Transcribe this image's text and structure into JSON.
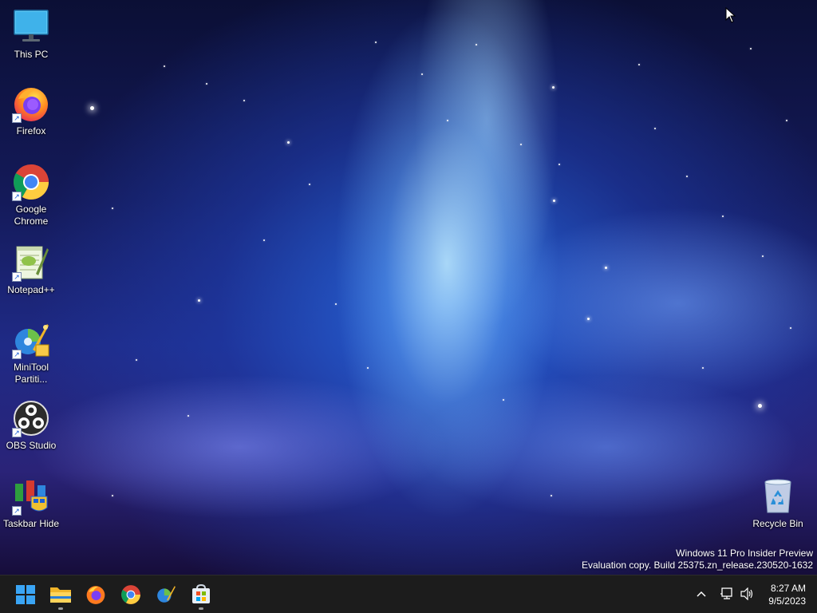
{
  "desktop": {
    "icons": [
      {
        "label": "This PC",
        "icon": "monitor-icon"
      },
      {
        "label": "Firefox",
        "icon": "firefox-icon"
      },
      {
        "label": "Google\nChrome",
        "icon": "chrome-icon"
      },
      {
        "label": "Notepad++",
        "icon": "notepad-plus-plus-icon"
      },
      {
        "label": "MiniTool\nPartiti...",
        "icon": "minitool-partition-icon"
      },
      {
        "label": "OBS Studio",
        "icon": "obs-studio-icon"
      },
      {
        "label": "Taskbar Hide",
        "icon": "taskbar-hide-icon"
      },
      {
        "label": "Recycle Bin",
        "icon": "recycle-bin-icon"
      }
    ],
    "shortcut_arrow": "↗"
  },
  "watermark": {
    "line1": "Windows 11 Pro Insider Preview",
    "line2": "Evaluation copy. Build 25375.zn_release.230520-1632"
  },
  "taskbar": {
    "pinned": [
      {
        "name": "Start",
        "icon": "windows-logo-icon"
      },
      {
        "name": "File Explorer",
        "icon": "folder-icon",
        "running": true
      },
      {
        "name": "Firefox",
        "icon": "firefox-icon"
      },
      {
        "name": "Google Chrome",
        "icon": "chrome-icon"
      },
      {
        "name": "MiniTool Partition Wizard",
        "icon": "minitool-partition-icon"
      },
      {
        "name": "Microsoft Store",
        "icon": "store-icon",
        "running": true
      }
    ],
    "tray": {
      "show_hidden": "^",
      "time": "8:27 AM",
      "date": "9/5/2023"
    },
    "accent_color": "#0078d4"
  }
}
